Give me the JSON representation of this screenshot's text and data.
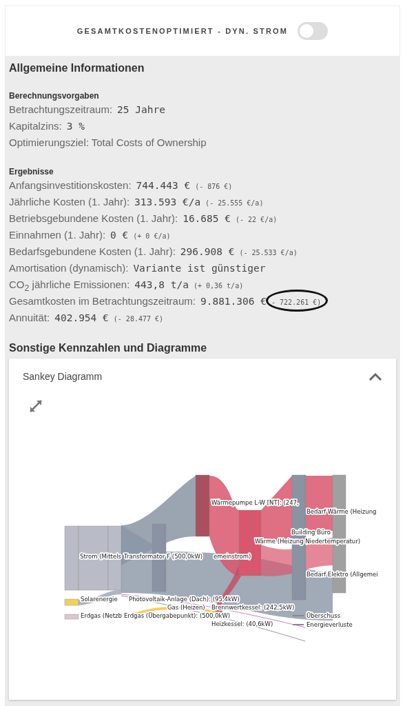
{
  "toggle": {
    "label": "GESAMTKOSTENOPTIMIERT - DYN. STROM",
    "on": false
  },
  "info": {
    "title": "Allgemeine Informationen",
    "groups": [
      {
        "heading": "Berechnungsvorgaben",
        "rows": [
          {
            "label": "Betrachtungszeitraum:",
            "value": "25 Jahre",
            "highlighted": false
          },
          {
            "label": "Kapitalzins:",
            "value": "3 %",
            "highlighted": false
          },
          {
            "label": "Optimierungsziel: Total Costs of Ownership",
            "highlighted": false
          }
        ]
      },
      {
        "heading": "Ergebnisse",
        "rows": [
          {
            "label": "Anfangsinvestitionskosten:",
            "value": "744.443 €",
            "delta": "(- 876 €)",
            "highlighted": false
          },
          {
            "label": "Jährliche Kosten (1. Jahr):",
            "value": "313.593 €/a",
            "delta": "(- 25.555 €/a)",
            "highlighted": false
          },
          {
            "label": "Betriebsgebundene Kosten (1. Jahr):",
            "value": "16.685 €",
            "delta": "(- 22 €/a)",
            "highlighted": false
          },
          {
            "label": "Einnahmen (1. Jahr):",
            "value": "0 €",
            "delta": "(+ 0 €/a)",
            "highlighted": false
          },
          {
            "label": "Bedarfsgebundene Kosten (1. Jahr):",
            "value": "296.908 €",
            "delta": "(- 25.533 €/a)",
            "highlighted": false
          },
          {
            "label": "Amortisation (dynamisch):",
            "value": "Variante ist günstiger",
            "highlighted": false
          },
          {
            "label": "CO$_{2}$ jährliche Emissionen:",
            "value": "443,8 t/a",
            "delta": "(+ 0,36 t/a)",
            "highlighted": false
          },
          {
            "label": "Gesamtkosten im Betrachtungszeitraum:",
            "value": "9.881.306 €",
            "delta": "- 722.261 €)",
            "highlighted": true
          },
          {
            "label": "Annuität:",
            "value": "402.954 €",
            "delta": "(- 28.477 €)",
            "highlighted": false
          }
        ]
      }
    ]
  },
  "other": {
    "title": "Sonstige Kennzahlen und Diagramme"
  },
  "sankey": {
    "title": "Sankey Diagramm",
    "expanded": true,
    "labels": [
      "Wärmepumpe L-W [NT]: (247,",
      "Bedarf Wärme (Heizung",
      "Building Büro",
      "Wärme (Heizung Niedertemperatur)",
      "Strom (Mittels",
      "Transformator F (500,0kW)",
      "emeinstrom)",
      "Bedarf Elektro (Allgemei",
      "Solarenergie",
      "Photovoltaik-Anlage (Dach): (95,4kW)",
      "Gas (Heizen)",
      "Brennwertkessel: (242,5kW)",
      "Erdgas (Netzb",
      "Erdgas (Übergabepunkt): (500,0kW)",
      "Heizkessel: (40,6kW)",
      "Überschuss",
      "Energieverluste"
    ]
  }
}
